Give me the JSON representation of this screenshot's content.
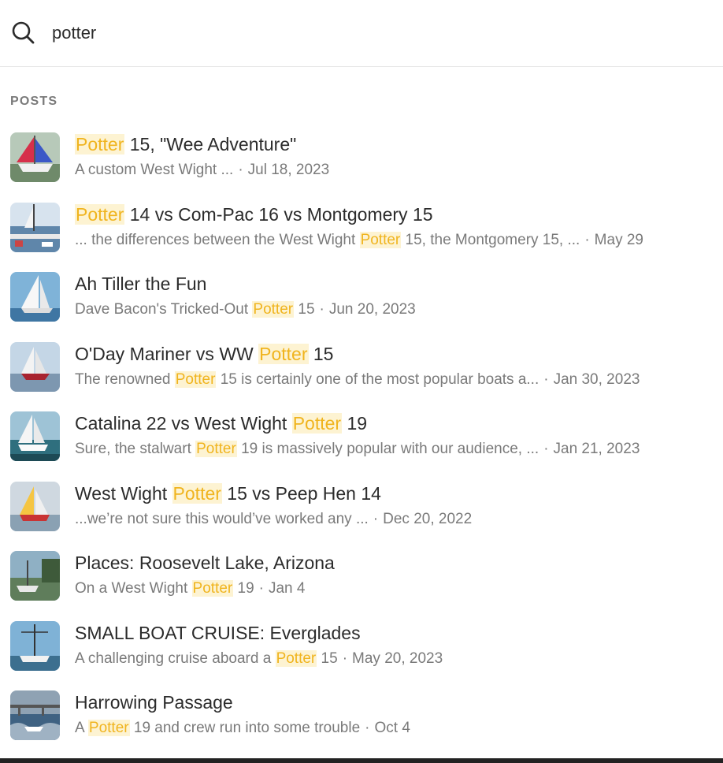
{
  "search": {
    "value": "potter",
    "placeholder": ""
  },
  "section": {
    "label": "POSTS"
  },
  "results": [
    {
      "title_pre": "",
      "title_hl": "Potter",
      "title_post": " 15, \"Wee Adventure\"",
      "meta_pre": "A custom West Wight ...",
      "meta_hl": "",
      "meta_post": "",
      "date": "Jul 18, 2023",
      "thumb": "sailboat-blue-red-sail"
    },
    {
      "title_pre": "",
      "title_hl": "Potter",
      "title_post": " 14 vs Com-Pac 16 vs Montgomery 15",
      "meta_pre": "... the differences between the West Wight ",
      "meta_hl": "Potter",
      "meta_post": " 15, the Montgomery 15, ...",
      "date": "May 29",
      "thumb": "sailboat-harbor"
    },
    {
      "title_pre": "Ah Tiller the Fun",
      "title_hl": "",
      "title_post": "",
      "meta_pre": "Dave Bacon's Tricked-Out ",
      "meta_hl": "Potter",
      "meta_post": " 15",
      "date": "Jun 20, 2023",
      "thumb": "sailboat-white-sail"
    },
    {
      "title_pre": "O'Day Mariner vs WW ",
      "title_hl": "Potter",
      "title_post": " 15",
      "meta_pre": "The renowned ",
      "meta_hl": "Potter",
      "meta_post": " 15 is certainly one of the most popular boats a...",
      "date": "Jan 30, 2023",
      "thumb": "sailboat-red-hull"
    },
    {
      "title_pre": "Catalina 22 vs West Wight ",
      "title_hl": "Potter",
      "title_post": " 19",
      "meta_pre": "Sure, the stalwart ",
      "meta_hl": "Potter",
      "meta_post": " 19 is massively popular with our audience, ...",
      "date": "Jan 21, 2023",
      "thumb": "sailboat-teal-water"
    },
    {
      "title_pre": "West Wight ",
      "title_hl": "Potter",
      "title_post": " 15 vs Peep Hen 14",
      "meta_pre": "...we’re not sure this would’ve worked any ...",
      "meta_hl": "",
      "meta_post": "",
      "date": "Dec 20, 2022",
      "thumb": "sailboat-yellow-sail"
    },
    {
      "title_pre": "Places: Roosevelt Lake, Arizona",
      "title_hl": "",
      "title_post": "",
      "meta_pre": "On a West Wight ",
      "meta_hl": "Potter",
      "meta_post": " 19",
      "date": "Jan 4",
      "thumb": "boat-on-shore"
    },
    {
      "title_pre": "SMALL BOAT CRUISE: Everglades",
      "title_hl": "",
      "title_post": "",
      "meta_pre": "A challenging cruise aboard a ",
      "meta_hl": "Potter",
      "meta_post": " 15",
      "date": "May 20, 2023",
      "thumb": "boat-mast-sky"
    },
    {
      "title_pre": "Harrowing Passage",
      "title_hl": "",
      "title_post": "",
      "meta_pre": "A ",
      "meta_hl": "Potter",
      "meta_post": " 19 and crew run into some trouble",
      "date": "Oct 4",
      "thumb": "bridge-stormy-water"
    }
  ],
  "colors": {
    "highlight_text": "#f0b41e",
    "highlight_bg": "#fdf3d2",
    "meta_text": "#7a7a7a"
  }
}
